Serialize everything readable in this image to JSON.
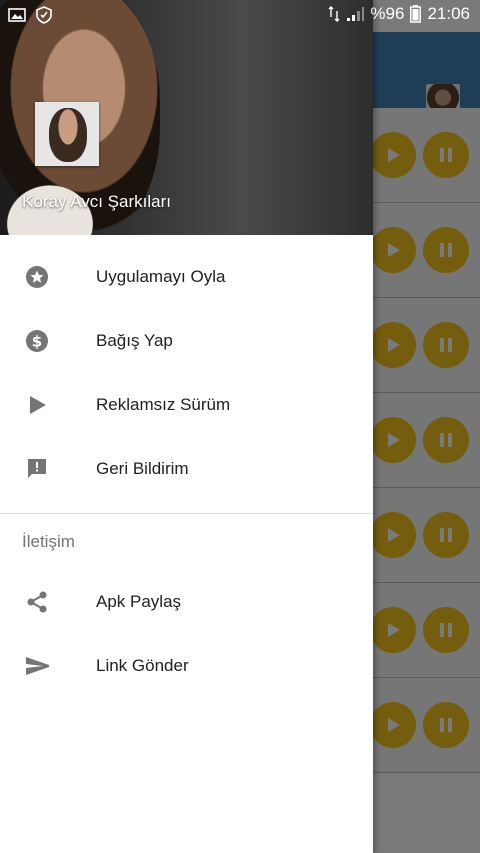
{
  "status_bar": {
    "battery_percent": "%96",
    "time": "21:06",
    "icons": [
      "gallery-icon",
      "shield-check-icon",
      "data-arrows-icon",
      "signal-icon",
      "battery-icon"
    ]
  },
  "drawer": {
    "header": {
      "title": "Koray Avcı Şarkıları"
    },
    "items": [
      {
        "label": "Uygulamayı Oyla",
        "icon": "star-circle-icon"
      },
      {
        "label": "Bağış Yap",
        "icon": "dollar-circle-icon"
      },
      {
        "label": "Reklamsız Sürüm",
        "icon": "play-icon"
      },
      {
        "label": "Geri Bildirim",
        "icon": "feedback-icon"
      }
    ],
    "section_title": "İletişim",
    "contact_items": [
      {
        "label": "Apk Paylaş",
        "icon": "share-icon"
      },
      {
        "label": "Link Gönder",
        "icon": "send-icon"
      }
    ]
  },
  "colors": {
    "toolbar": "#3f7fb7",
    "player_button": "#f2c21b",
    "icon_gray": "#757575"
  }
}
